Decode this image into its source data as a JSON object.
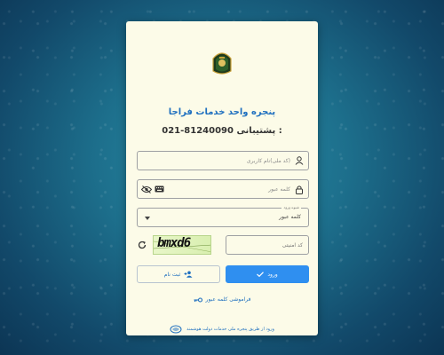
{
  "header": {
    "title": "پنجره واحد خدمات فراجا",
    "support_number": "021-81240090",
    "support_label": ": پشتیبانی"
  },
  "form": {
    "username_placeholder": "(کد ملی)نام کاربری",
    "password_placeholder": "کلمه عبور",
    "login_method_label": "شیوه ورود",
    "login_method_value": "کلمه عبور",
    "captcha_placeholder": "کد امنیتی",
    "captcha_text": "bmxd6"
  },
  "actions": {
    "login_label": "ورود",
    "register_label": "ثبت نام",
    "forgot_label": "فراموشی کلمه عبور",
    "gov_login_label": "ورود از طریق پنجره ملی خدمات دولت هوشمند"
  },
  "colors": {
    "accent": "#2f8ff0",
    "link": "#1e6fbf",
    "card_bg": "#fcfbe8"
  }
}
